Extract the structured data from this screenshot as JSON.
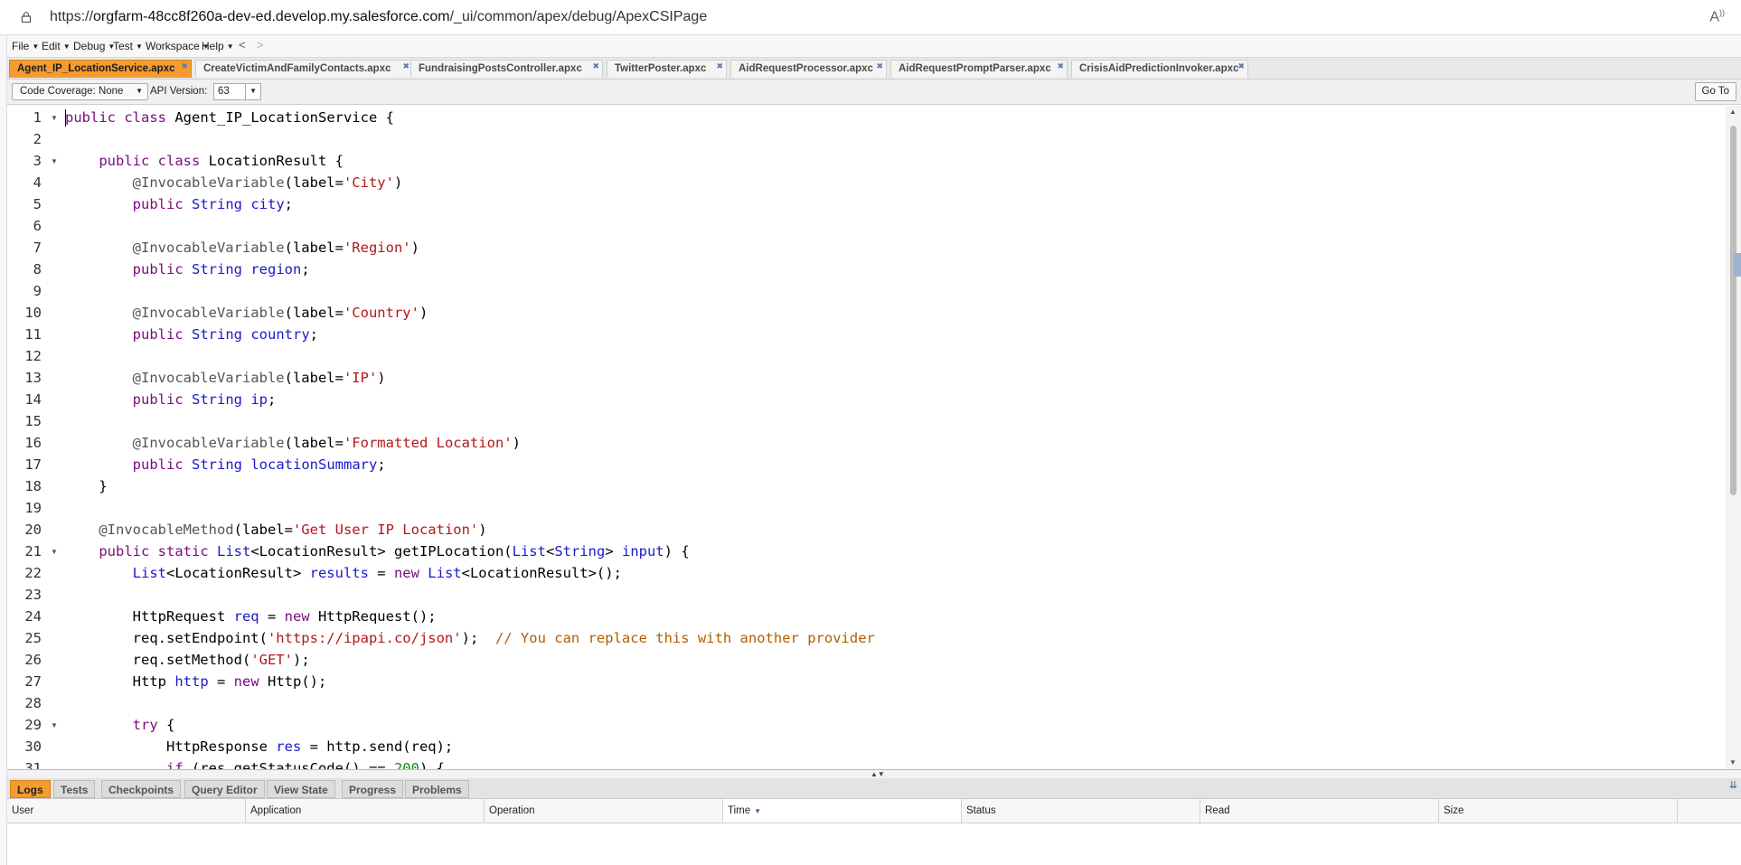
{
  "address_bar": {
    "url_prefix": "https://",
    "url_host": "orgfarm-48cc8f260a-dev-ed.develop.my.salesforce.com",
    "url_path": "/_ui/common/apex/debug/ApexCSIPage",
    "reader_icon": "Á"
  },
  "menu": {
    "items": [
      {
        "label": "File"
      },
      {
        "label": "Edit"
      },
      {
        "label": "Debug"
      },
      {
        "label": "Test"
      },
      {
        "label": "Workspace"
      },
      {
        "label": "Help"
      }
    ],
    "back": "<",
    "forward": ">"
  },
  "tabs": [
    {
      "label": "Agent_IP_LocationService.apxc",
      "active": true
    },
    {
      "label": "CreateVictimAndFamilyContacts.apxc"
    },
    {
      "label": "FundraisingPostsController.apxc"
    },
    {
      "label": "TwitterPoster.apxc"
    },
    {
      "label": "AidRequestProcessor.apxc"
    },
    {
      "label": "AidRequestPromptParser.apxc"
    },
    {
      "label": "CrisisAidPredictionInvoker.apxc"
    }
  ],
  "toolbar": {
    "code_coverage": "Code Coverage: None",
    "api_version_label": "API Version:",
    "api_version_value": "63",
    "go_to": "Go To"
  },
  "editor": {
    "line_numbers": [
      "1",
      "2",
      "3",
      "4",
      "5",
      "6",
      "7",
      "8",
      "9",
      "10",
      "11",
      "12",
      "13",
      "14",
      "15",
      "16",
      "17",
      "18",
      "19",
      "20",
      "21",
      "22",
      "23",
      "24",
      "25",
      "26",
      "27",
      "28",
      "29",
      "30",
      "31"
    ],
    "folded_lines": [
      1,
      3,
      21,
      29
    ]
  },
  "bottom_tabs": [
    {
      "label": "Logs",
      "active": true
    },
    {
      "label": "Tests"
    },
    {
      "label": "Checkpoints"
    },
    {
      "label": "Query Editor"
    },
    {
      "label": "View State"
    },
    {
      "label": "Progress"
    },
    {
      "label": "Problems"
    }
  ],
  "log_columns": [
    "User",
    "Application",
    "Operation",
    "Time",
    "Status",
    "Read",
    "Size"
  ],
  "sorted_column": "Time",
  "colors": {
    "active_tab": "#f59b2f",
    "keyword": "#7a0b7f",
    "type": "#1a1ac9",
    "string": "#b21818",
    "comment": "#b05d00",
    "number": "#128a12"
  }
}
